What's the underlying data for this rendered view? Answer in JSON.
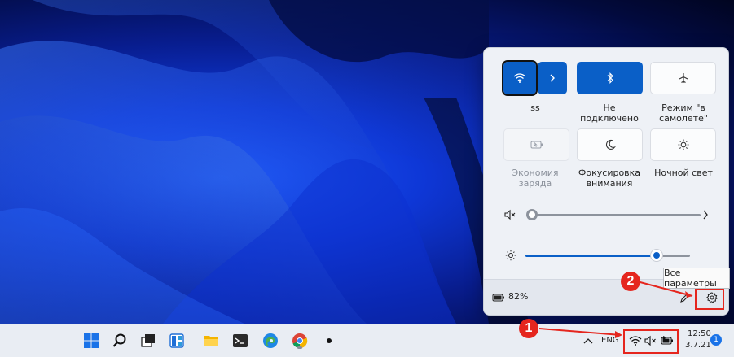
{
  "quick_settings": {
    "tiles": {
      "wifi": {
        "label": "ss",
        "state": "on",
        "icon": "wifi-icon"
      },
      "bluetooth": {
        "label": "Не подключено",
        "state": "on",
        "icon": "bluetooth-icon"
      },
      "airplane": {
        "label_line1": "Режим \"в",
        "label_line2": "самолете\"",
        "state": "off",
        "icon": "airplane-icon"
      },
      "battery_saver": {
        "label_line1": "Экономия",
        "label_line2": "заряда",
        "state": "disabled",
        "icon": "battery-saver-icon"
      },
      "focus": {
        "label_line1": "Фокусировка",
        "label_line2": "внимания",
        "state": "off",
        "icon": "moon-icon"
      },
      "night_light": {
        "label": "Ночной свет",
        "state": "off",
        "icon": "sun-icon"
      }
    },
    "volume": {
      "level": 0,
      "muted": true,
      "icon": "speaker-muted-icon"
    },
    "brightness": {
      "level": 0.82,
      "icon": "brightness-icon"
    },
    "battery": {
      "percent": "82%",
      "icon": "battery-icon"
    },
    "footer": {
      "edit_icon": "pencil-icon",
      "settings_icon": "gear-icon"
    }
  },
  "tooltip": {
    "text": "Все параметры"
  },
  "callouts": [
    {
      "number": "1"
    },
    {
      "number": "2"
    }
  ],
  "taskbar": {
    "apps": [
      "start-icon",
      "search-icon",
      "task-view-icon",
      "widgets-icon",
      "file-explorer-icon",
      "terminal-icon",
      "edge-icon",
      "chrome-icon",
      "dot-icon"
    ],
    "tray": {
      "language": "ENG",
      "time": "12:50",
      "date": "3.7.21",
      "notifications": "1"
    }
  },
  "colors": {
    "accent": "#0a5fc7",
    "callout": "#e5261e"
  }
}
